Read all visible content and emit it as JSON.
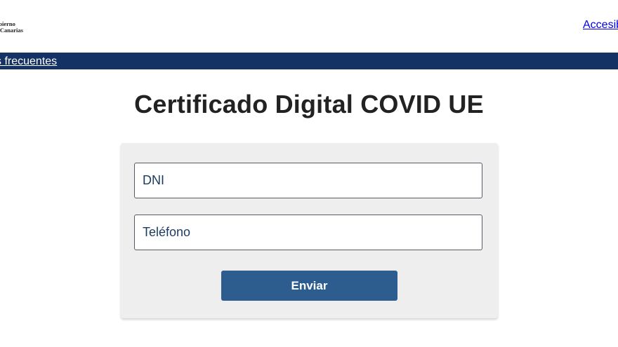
{
  "header": {
    "logo_line1": "obierno",
    "logo_line2": "e Canarias",
    "accessibility_link": "Accesib"
  },
  "nav": {
    "faq_link": "s frecuentes"
  },
  "main": {
    "title": "Certificado Digital COVID UE"
  },
  "form": {
    "dni_placeholder": "DNI",
    "dni_value": "",
    "phone_placeholder": "Teléfono",
    "phone_value": "",
    "submit_label": "Enviar"
  },
  "colors": {
    "navbar": "#143263",
    "button": "#2d5c8e",
    "card": "#eeeeee",
    "field_text": "#1b3a5f"
  }
}
